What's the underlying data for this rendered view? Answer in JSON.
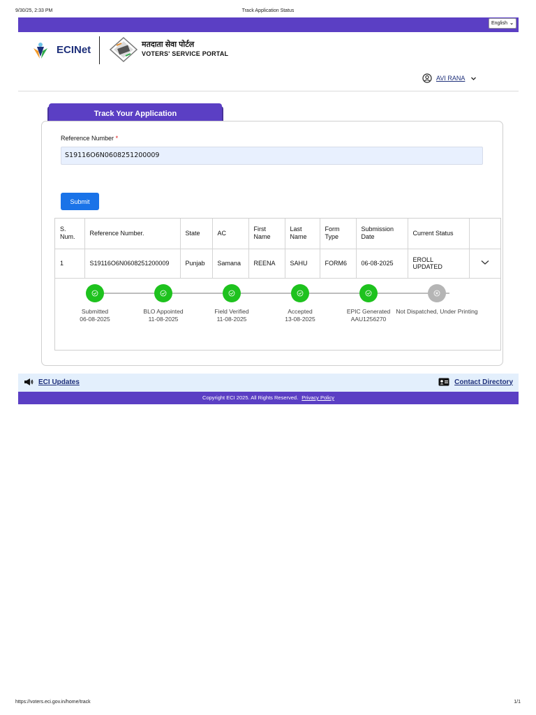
{
  "print_header": {
    "date": "9/30/25, 2:33 PM",
    "title": "Track Application Status"
  },
  "print_footer": {
    "url": "https://voters.eci.gov.in/home/track",
    "page": "1/1"
  },
  "top_bar": {
    "language": "English"
  },
  "header": {
    "ecinet": "ECINet",
    "portal_hindi": "मतदाता सेवा पोर्टल",
    "portal_english": "VOTERS' SERVICE PORTAL",
    "user_name": "AVI RANA"
  },
  "tab": {
    "label": "Track Your Application"
  },
  "form": {
    "reference_label": "Reference Number",
    "required_mark": "*",
    "reference_value": "S19116O6N0608251200009",
    "submit_label": "Submit"
  },
  "table": {
    "headers": [
      "S. Num.",
      "Reference Number.",
      "State",
      "AC",
      "First Name",
      "Last Name",
      "Form Type",
      "Submission Date",
      "Current Status",
      ""
    ],
    "rows": [
      {
        "s_num": "1",
        "reference": "S19116O6N0608251200009",
        "state": "Punjab",
        "ac": "Samana",
        "first_name": "REENA",
        "last_name": "SAHU",
        "form_type": "FORM6",
        "submission_date": "06-08-2025",
        "current_status": "EROLL UPDATED"
      }
    ]
  },
  "steps": [
    {
      "label": "Submitted",
      "sub": "06-08-2025",
      "status": "done"
    },
    {
      "label": "BLO Appointed",
      "sub": "11-08-2025",
      "status": "done"
    },
    {
      "label": "Field Verified",
      "sub": "11-08-2025",
      "status": "done"
    },
    {
      "label": "Accepted",
      "sub": "13-08-2025",
      "status": "done"
    },
    {
      "label": "EPIC Generated",
      "sub": "AAU1256270",
      "status": "done"
    },
    {
      "label": "Not Dispatched, Under Printing",
      "sub": "",
      "status": "pending"
    }
  ],
  "footer": {
    "eci_updates": "ECI Updates",
    "contact_directory": "Contact Directory",
    "copyright": "Copyright ECI 2025. All Rights Reserved.",
    "privacy_policy": "Privacy Policy"
  },
  "colors": {
    "brand_purple": "#5b3fc4",
    "submit_blue": "#1a73e8",
    "step_done": "#1ec21e",
    "step_pending": "#b5b5b5"
  }
}
